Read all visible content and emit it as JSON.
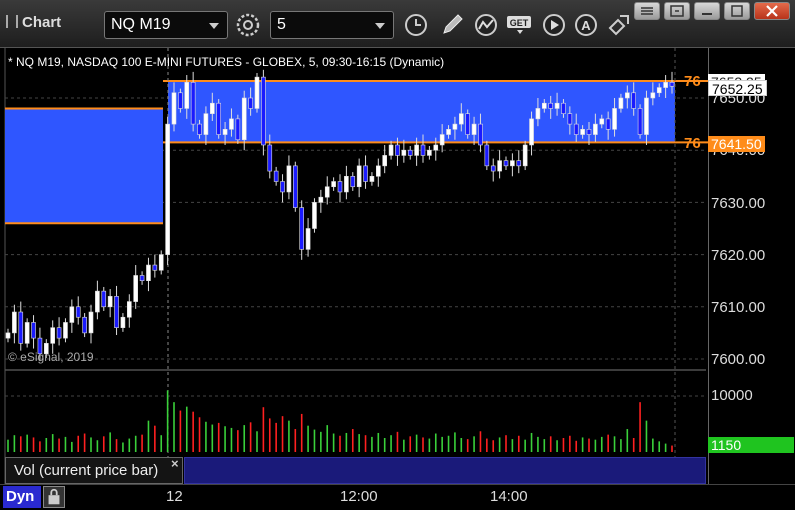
{
  "app": {
    "title": "Chart"
  },
  "toolbar": {
    "symbol": "NQ M19",
    "interval": "5"
  },
  "chart": {
    "caption": "* NQ M19, NASDAQ 100 E-MINI FUTURES - GLOBEX, 5, 09:30-16:15 (Dynamic)",
    "copyright": "© eSignal, 2019",
    "upper_level_tag": "76",
    "lower_level_tag": "76",
    "current_price": "7652.25",
    "upper_level_price": "7653.25",
    "lower_level_price": "7641.50",
    "y_ticks": [
      "7650.00",
      "7640.00",
      "7630.00",
      "7620.00",
      "7610.00",
      "7600.00"
    ],
    "x_ticks": [
      "12",
      "12:00",
      "14:00"
    ],
    "colors": {
      "background": "#000000",
      "zone": "#2f56ff",
      "level_line": "#ff8c1a",
      "up": "#ffffff",
      "down": "#1a1aff"
    }
  },
  "volume": {
    "panel_label": "Vol (current price bar)",
    "tick_10000": "10000",
    "current_value": "1150",
    "colors": {
      "up": "#3ad13a",
      "down": "#ff2020",
      "current_box": "#1fc41f"
    }
  },
  "status": {
    "mode": "Dyn"
  },
  "chart_data": [
    {
      "type": "candlestick",
      "title": "* NQ M19, NASDAQ 100 E-MINI FUTURES - GLOBEX, 5, 09:30-16:15 (Dynamic)",
      "x_ticks": [
        "12",
        "12:00",
        "14:00"
      ],
      "ylim": [
        7597,
        7658
      ],
      "y_ticks": [
        7600,
        7610,
        7620,
        7630,
        7640,
        7650
      ],
      "levels": [
        7653.25,
        7641.5
      ],
      "zones": [
        [
          7641.5,
          7653.25
        ]
      ],
      "prior_zone": [
        7626,
        7648
      ],
      "last": 7652.25,
      "close": [
        7605,
        7609,
        7603,
        7607,
        7604,
        7601,
        7603,
        7606,
        7604,
        7607,
        7610,
        7608,
        7605,
        7609,
        7613,
        7610,
        7612,
        7606,
        7608,
        7611,
        7616,
        7615,
        7618,
        7617,
        7620,
        7645,
        7651,
        7648,
        7653,
        7645,
        7643,
        7647,
        7649,
        7643,
        7644,
        7646,
        7642,
        7650,
        7648,
        7654,
        7641,
        7636,
        7634,
        7632,
        7637,
        7629,
        7621,
        7625,
        7630,
        7631,
        7633,
        7634,
        7632,
        7635,
        7633,
        7637,
        7634,
        7635,
        7637,
        7639,
        7641,
        7639,
        7640,
        7639,
        7641,
        7639,
        7640,
        7641,
        7643,
        7644,
        7645,
        7647,
        7643,
        7645,
        7641,
        7637,
        7636,
        7638,
        7637,
        7638,
        7637,
        7641,
        7646,
        7648,
        7649,
        7648,
        7649,
        7647,
        7645,
        7643,
        7644,
        7643,
        7645,
        7646,
        7644,
        7648,
        7650,
        7651,
        7648,
        7643,
        7650,
        7651,
        7652,
        7653,
        7652.25
      ]
    },
    {
      "type": "bar",
      "title": "Vol (current price bar)",
      "y_ticks": [
        10000
      ],
      "last": 1150,
      "values": [
        2200,
        3000,
        2800,
        3100,
        2600,
        1900,
        2500,
        3200,
        2400,
        2700,
        1800,
        2900,
        3300,
        2600,
        2100,
        2800,
        3500,
        2300,
        1700,
        2400,
        2900,
        3100,
        5600,
        4700,
        3000,
        11000,
        8900,
        7400,
        8100,
        7200,
        6200,
        5400,
        4900,
        5200,
        4600,
        4300,
        3900,
        4800,
        5300,
        3700,
        8000,
        6000,
        5200,
        6400,
        5600,
        4100,
        6800,
        4700,
        4000,
        3600,
        4800,
        3300,
        2900,
        3400,
        4100,
        3200,
        3000,
        2700,
        3400,
        2500,
        3000,
        3600,
        2200,
        2800,
        3100,
        2600,
        2400,
        3300,
        2700,
        2900,
        3500,
        2500,
        2300,
        2800,
        3700,
        2400,
        2100,
        2600,
        3000,
        2300,
        2900,
        2200,
        3400,
        2700,
        2300,
        2800,
        2100,
        2500,
        2900,
        2000,
        2600,
        2400,
        2200,
        2700,
        3100,
        2800,
        2300,
        4100,
        2500,
        8900,
        5600,
        2400,
        1900,
        1500,
        1150
      ]
    }
  ]
}
